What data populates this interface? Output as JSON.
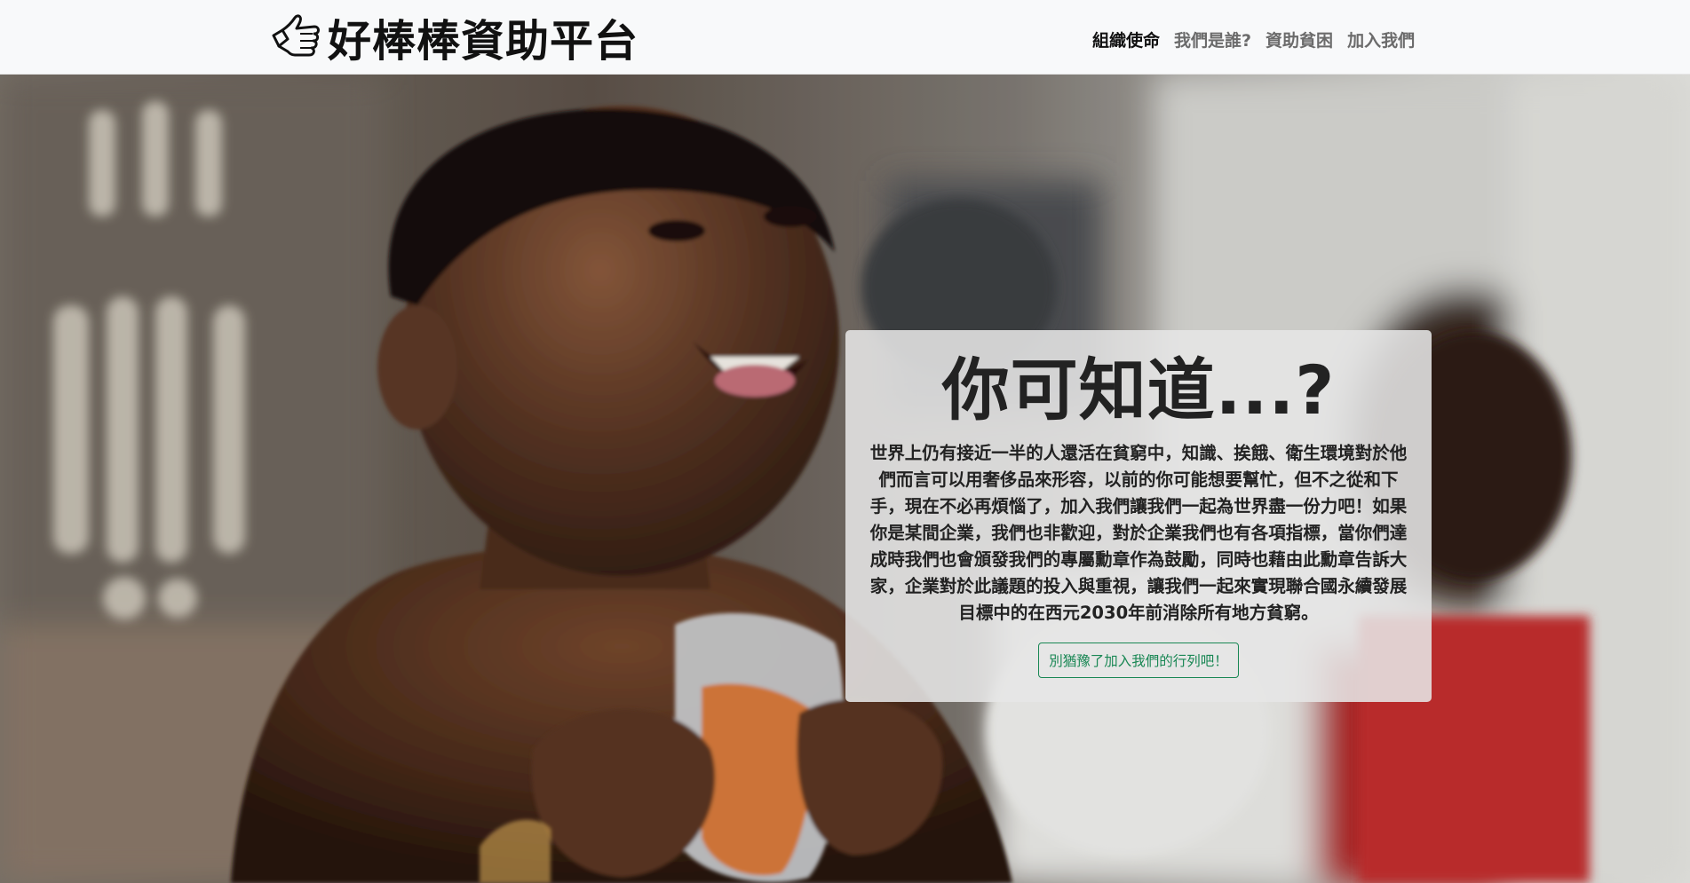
{
  "navbar": {
    "brand_text": "好棒棒資助平台",
    "brand_icon": "thumbs-up-icon",
    "links": [
      {
        "label": "組織使命",
        "active": true
      },
      {
        "label": "我們是誰?",
        "active": false
      },
      {
        "label": "資助貧困",
        "active": false
      },
      {
        "label": "加入我們",
        "active": false
      }
    ]
  },
  "hero": {
    "image_subject": "smiling child holding a snack bag",
    "card": {
      "title": "你可知道...?",
      "body": "世界上仍有接近一半的人還活在貧窮中，知識、挨餓、衛生環境對於他們而言可以用奢侈品來形容，以前的你可能想要幫忙，但不之從和下手，現在不必再煩惱了，加入我們讓我們一起為世界盡一份力吧！如果你是某間企業，我們也非歡迎，對於企業我們也有各項指標，當你們達成時我們也會頒發我們的專屬勳章作為鼓勵，同時也藉由此勳章告訴大家，企業對於此議題的投入與重視，讓我們一起來實現聯合國永續發展目標中的在西元2030年前消除所有地方貧窮。",
      "button_label": "別猶豫了加入我們的行列吧！"
    }
  },
  "colors": {
    "navbar_bg": "#f8f9fa",
    "cta_green": "#198754",
    "card_bg": "#e6e6e6"
  }
}
